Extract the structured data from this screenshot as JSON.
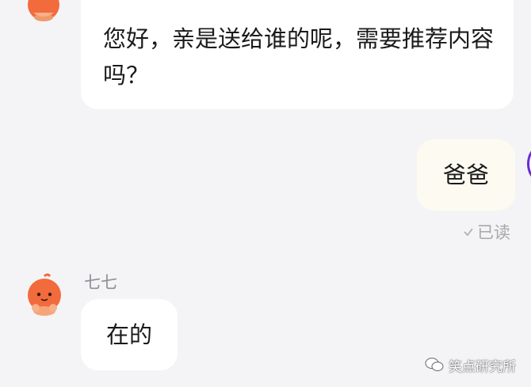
{
  "messages": [
    {
      "from": "other",
      "text": "您好，亲是送给谁的呢，需要推荐内容吗？"
    },
    {
      "from": "me",
      "text": "爸爸",
      "status": "已读"
    },
    {
      "from": "other",
      "sender": "七七",
      "text": "在的"
    }
  ],
  "watermark": {
    "text": "笑点研究所"
  },
  "colors": {
    "background": "#f4f4f6",
    "bubble_other": "#ffffff",
    "bubble_me": "#fdfbf1",
    "avatar_orange": "#f26b3d",
    "avatar_ring": "#6a2ad8"
  },
  "icons": {
    "avatar": "orange-mascot-icon",
    "read": "check-icon",
    "watermark": "wechat-logo-icon"
  }
}
